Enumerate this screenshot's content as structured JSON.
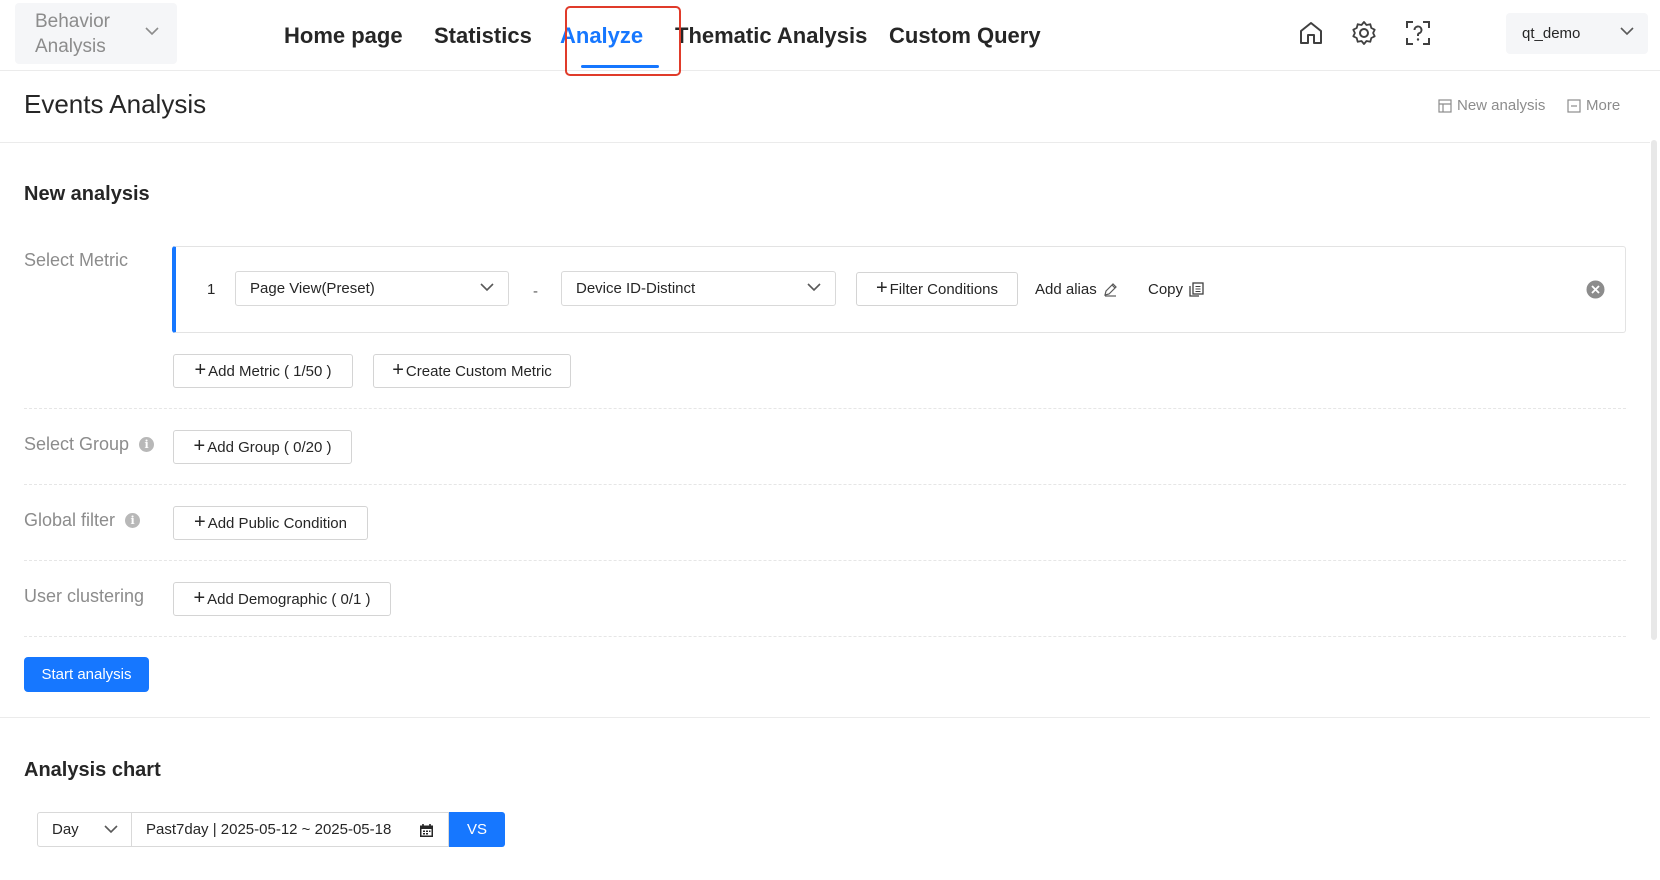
{
  "app_switcher": {
    "label": "Behavior Analysis"
  },
  "nav": {
    "items": [
      {
        "label": "Home page"
      },
      {
        "label": "Statistics"
      },
      {
        "label": "Analyze"
      },
      {
        "label": "Thematic Analysis"
      },
      {
        "label": "Custom Query"
      }
    ],
    "active": "Analyze"
  },
  "top_icons": [
    "home-icon",
    "gear-icon",
    "help-scan-icon"
  ],
  "user": {
    "name": "qt_demo"
  },
  "page": {
    "title": "Events Analysis",
    "actions": {
      "new_analysis": "New analysis",
      "more": "More"
    }
  },
  "new_analysis": {
    "title": "New analysis",
    "select_metric": {
      "label": "Select Metric",
      "metrics": [
        {
          "index": "1",
          "event": "Page View(Preset)",
          "separator": "-",
          "measure": "Device ID-Distinct",
          "filter_label": "Filter Conditions",
          "alias_label": "Add alias",
          "copy_label": "Copy"
        }
      ],
      "add_metric": "Add Metric ( 1/50 )",
      "custom_metric": "Create Custom Metric"
    },
    "select_group": {
      "label": "Select Group",
      "button": "Add Group ( 0/20 )"
    },
    "global_filter": {
      "label": "Global filter",
      "button": "Add Public Condition"
    },
    "user_clustering": {
      "label": "User clustering",
      "button": "Add Demographic ( 0/1 )"
    },
    "start_button": "Start analysis"
  },
  "analysis_chart": {
    "title": "Analysis chart",
    "granularity": "Day",
    "date_range": "Past7day | 2025-05-12 ~ 2025-05-18",
    "vs_label": "VS"
  },
  "colors": {
    "accent": "#1677ff",
    "highlight": "#e03b2a"
  }
}
